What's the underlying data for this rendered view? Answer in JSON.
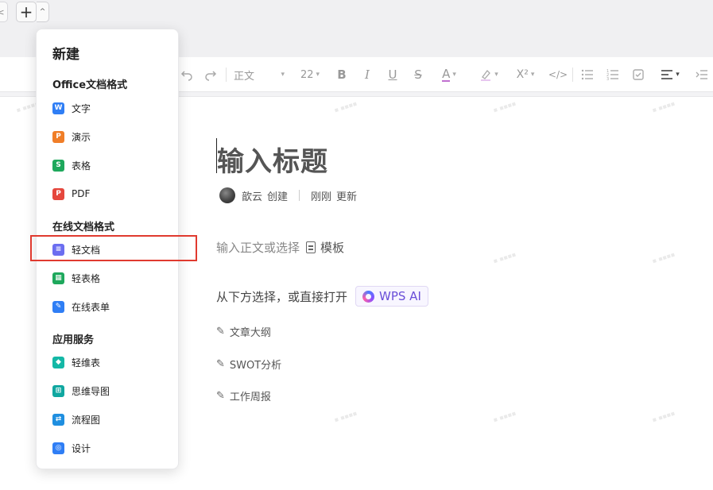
{
  "tabbar": {
    "prev_glyph": "<",
    "new_tab_glyph": "+",
    "new_tab_caret": "^"
  },
  "toolbar": {
    "undo_icon": "undo-icon",
    "redo_icon": "redo-icon",
    "paragraph_style": "正文",
    "font_size": "22",
    "bold": "B",
    "italic": "I",
    "underline": "U",
    "strike": "S",
    "font_color": "A",
    "superscript": "X²",
    "code": "</>"
  },
  "menu": {
    "title": "新建",
    "sections": [
      {
        "title": "Office文档格式",
        "items": [
          {
            "label": "文字",
            "icon": "word-icon",
            "color": "#2f7ef5",
            "glyph": "W"
          },
          {
            "label": "演示",
            "icon": "presentation-icon",
            "color": "#f07e28",
            "glyph": "P"
          },
          {
            "label": "表格",
            "icon": "spreadsheet-icon",
            "color": "#1ea85c",
            "glyph": "S"
          },
          {
            "label": "PDF",
            "icon": "pdf-icon",
            "color": "#e5473d",
            "glyph": "P"
          }
        ]
      },
      {
        "title": "在线文档格式",
        "items": [
          {
            "label": "轻文档",
            "icon": "light-doc-icon",
            "color": "#6b6ef0",
            "glyph": "≡"
          },
          {
            "label": "轻表格",
            "icon": "light-sheet-icon",
            "color": "#1ea85c",
            "glyph": "▦"
          },
          {
            "label": "在线表单",
            "icon": "online-form-icon",
            "color": "#2f7ef5",
            "glyph": "✎"
          }
        ]
      },
      {
        "title": "应用服务",
        "items": [
          {
            "label": "轻维表",
            "icon": "light-table-icon",
            "color": "#14b8a6",
            "glyph": "◆"
          },
          {
            "label": "思维导图",
            "icon": "mindmap-icon",
            "color": "#10a7a0",
            "glyph": "⊞"
          },
          {
            "label": "流程图",
            "icon": "flowchart-icon",
            "color": "#1f8fe0",
            "glyph": "⇄"
          },
          {
            "label": "设计",
            "icon": "design-icon",
            "color": "#2f7ef5",
            "glyph": "◎"
          }
        ]
      }
    ]
  },
  "editor": {
    "title_placeholder": "输入标题",
    "author": "歆云",
    "created": "创建",
    "time": "刚刚",
    "updated": "更新",
    "body_placeholder": "输入正文或选择",
    "template_label": "模板",
    "choose_text": "从下方选择，或直接打开",
    "wps_ai": "WPS AI",
    "suggestions": [
      "文章大纲",
      "SWOT分析",
      "工作周报"
    ]
  },
  "colors": {
    "accent_highlight": "#e03a2f",
    "ai_purple": "#6a4fd8"
  }
}
